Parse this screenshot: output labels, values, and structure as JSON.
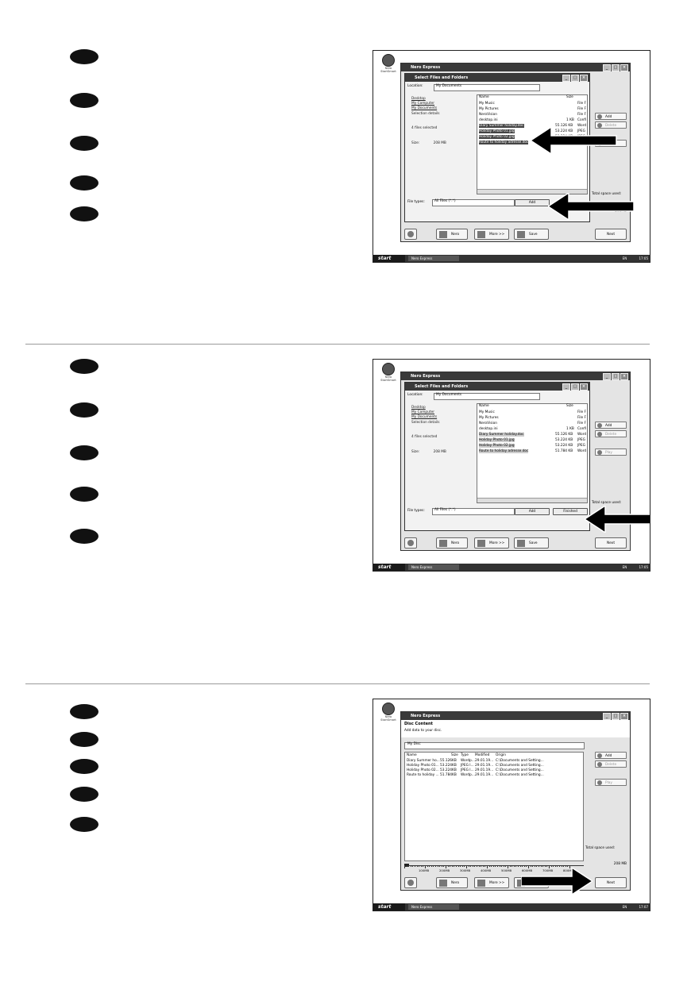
{
  "bullets": [
    "",
    "",
    "",
    "",
    "",
    "",
    "",
    "",
    "",
    "",
    "",
    "",
    "",
    "",
    ""
  ],
  "screens": [
    {
      "desktop_icon": "Nero StartSmart",
      "app_title": "Nero Express",
      "dialog_title": "Select Files and Folders",
      "location_label": "Location:",
      "location_value": "My Documents",
      "left_links": [
        "Desktop",
        "My Computer",
        "My Documents"
      ],
      "selection_details": "Selection details",
      "files_selected": "4 files selected",
      "size_label": "Size:",
      "size_value": "208 MB",
      "col_name": "Name",
      "col_size": "Size",
      "files": [
        {
          "name": "My Music",
          "size": "",
          "type": "File F"
        },
        {
          "name": "My Pictures",
          "size": "",
          "type": "File F"
        },
        {
          "name": "NeroVision",
          "size": "",
          "type": "File F"
        },
        {
          "name": "desktop.ini",
          "size": "1 KB",
          "type": "Confi"
        },
        {
          "name": "Diary Summer holiday.doc",
          "size": "55.126 KB",
          "type": "Word"
        },
        {
          "name": "Holiday Photo 01.jpg",
          "size": "53.224 KB",
          "type": "JPEG"
        },
        {
          "name": "Holiday Photo 02.jpg",
          "size": "53.224 KB",
          "type": "JPEG"
        },
        {
          "name": "Route to holiday adresse.doc",
          "size": "51.784 KB",
          "type": "Word"
        }
      ],
      "file_types_label": "File types:",
      "file_types_value": "All Files (*.*)",
      "add_button": "Add",
      "finished_button": "Finished",
      "right_add": "Add",
      "right_delete": "Delete",
      "right_play": "Play",
      "total_space": "Total space used:",
      "total_value": "208MB",
      "nero_button": "Nero",
      "more_button": "More >>",
      "save_button": "Save",
      "next_button": "Next",
      "start_label": "start",
      "taskbar_item": "Nero Express",
      "tray": "EN",
      "clock": "17:05"
    },
    {
      "desktop_icon": "Nero StartSmart",
      "app_title": "Nero Express",
      "dialog_title": "Select Files and Folders",
      "location_label": "Location:",
      "location_value": "My Documents",
      "left_links": [
        "Desktop",
        "My Computer",
        "My Documents"
      ],
      "selection_details": "Selection details",
      "files_selected": "4 files selected",
      "size_label": "Size:",
      "size_value": "208 MB",
      "col_name": "Name",
      "col_size": "Size",
      "files": [
        {
          "name": "My Music",
          "size": "",
          "type": "File F"
        },
        {
          "name": "My Pictures",
          "size": "",
          "type": "File F"
        },
        {
          "name": "NeroVision",
          "size": "",
          "type": "File F"
        },
        {
          "name": "desktop.ini",
          "size": "1 KB",
          "type": "Confi"
        },
        {
          "name": "Diary Summer holiday.doc",
          "size": "55.126 KB",
          "type": "Word"
        },
        {
          "name": "Holiday Photo 01.jpg",
          "size": "53.224 KB",
          "type": "JPEG"
        },
        {
          "name": "Holiday Photo 02.jpg",
          "size": "53.224 KB",
          "type": "JPEG"
        },
        {
          "name": "Route to holiday adresse.doc",
          "size": "51.784 KB",
          "type": "Word"
        }
      ],
      "file_types_label": "File types:",
      "file_types_value": "All Files (*.*)",
      "add_button": "Add",
      "finished_button": "Finished",
      "right_add": "Add",
      "right_delete": "Delete",
      "right_play": "Play",
      "total_space": "Total space used:",
      "total_value": "208 MB",
      "nero_button": "Nero",
      "more_button": "More >>",
      "save_button": "Save",
      "next_button": "Next",
      "start_label": "start",
      "taskbar_item": "Nero Express",
      "tray": "EN",
      "clock": "17:05"
    },
    {
      "desktop_icon": "Nero StartSmart",
      "app_title": "Nero Express",
      "section_title": "Disc Content",
      "section_sub": "Add data to your disc.",
      "disc_name": "My Disc",
      "cols": [
        "Name",
        "Size",
        "Type",
        "Modified",
        "Origin"
      ],
      "rows": [
        [
          "Diary Summer ho...",
          "55.126KB",
          "Wordp...",
          "29.01.19...",
          "C:\\Documents and Setting..."
        ],
        [
          "Holiday Photo 01...",
          "53.224KB",
          "JPEG I...",
          "29.01.19...",
          "C:\\Documents and Setting..."
        ],
        [
          "Holiday Photo 02...",
          "53.224KB",
          "JPEG I...",
          "29.01.19...",
          "C:\\Documents and Setting..."
        ],
        [
          "Route to holiday ...",
          "51.784KB",
          "Wordp...",
          "29.01.19...",
          "C:\\Documents and Setting..."
        ]
      ],
      "right_add": "Add",
      "right_delete": "Delete",
      "right_play": "Play",
      "total_space": "Total space used:",
      "total_value": "208 MB",
      "ruler_labels": [
        "100MB",
        "200MB",
        "300MB",
        "400MB",
        "500MB",
        "600MB",
        "700MB",
        "800MB"
      ],
      "nero_button": "Nero",
      "more_button": "More >>",
      "save_button": "Save",
      "next_button": "Next",
      "start_label": "start",
      "taskbar_item": "Nero Express",
      "tray": "EN",
      "clock": "17:07"
    }
  ]
}
